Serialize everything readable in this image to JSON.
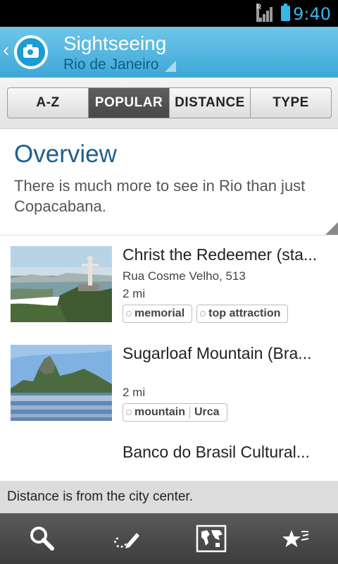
{
  "status": {
    "time": "9:40",
    "roaming_label": "R"
  },
  "actionbar": {
    "title": "Sightseeing",
    "subtitle": "Rio de Janeiro",
    "logo": "camera-icon"
  },
  "tabs": [
    {
      "label": "A-Z",
      "active": false
    },
    {
      "label": "POPULAR",
      "active": true
    },
    {
      "label": "DISTANCE",
      "active": false
    },
    {
      "label": "TYPE",
      "active": false
    }
  ],
  "overview": {
    "title": "Overview",
    "text": "There is much more to see in Rio than just Copacabana."
  },
  "items": [
    {
      "title": "Christ the Redeemer (sta...",
      "address": "Rua Cosme Velho, 513",
      "distance": "2 mi",
      "tags": [
        "memorial",
        "top attraction"
      ]
    },
    {
      "title": "Sugarloaf Mountain (Bra...",
      "address": "",
      "distance": "2 mi",
      "tags": [
        "mountain",
        "Urca"
      ]
    },
    {
      "title": "Banco do Brasil Cultural...",
      "address": "",
      "distance": "",
      "tags": []
    }
  ],
  "footer_note": "Distance is from the city center.",
  "bottom_nav": [
    "search-icon",
    "route-pencil-icon",
    "world-map-icon",
    "favorite-stars-icon"
  ],
  "colors": {
    "accent": "#38b6e8",
    "title_blue": "#1f5f8b",
    "actionbar": "#4aaedb"
  }
}
